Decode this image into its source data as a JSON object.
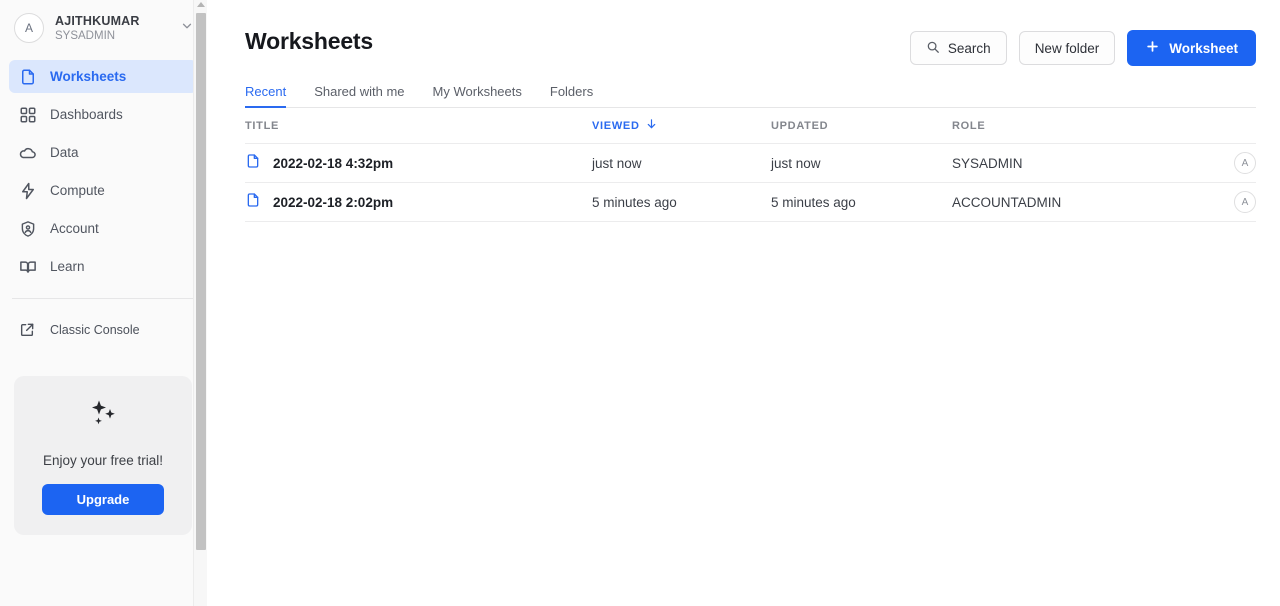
{
  "sidebar": {
    "account": {
      "avatar_initial": "A",
      "name": "AJITHKUMAR",
      "role": "SYSADMIN",
      "chevron_icon": "chevron-down-icon"
    },
    "nav_items": [
      {
        "label": "Worksheets",
        "icon": "document-icon",
        "active": true
      },
      {
        "label": "Dashboards",
        "icon": "grid-icon",
        "active": false
      },
      {
        "label": "Data",
        "icon": "cloud-icon",
        "active": false
      },
      {
        "label": "Compute",
        "icon": "lightning-icon",
        "active": false
      },
      {
        "label": "Account",
        "icon": "shield-person-icon",
        "active": false
      },
      {
        "label": "Learn",
        "icon": "book-icon",
        "active": false
      }
    ],
    "classic_console": {
      "label": "Classic Console",
      "icon": "external-link-icon"
    },
    "trial_card": {
      "icon": "sparkles-icon",
      "message": "Enjoy your free trial!",
      "upgrade_label": "Upgrade"
    },
    "scrollbar": {
      "up_arrow_icon": "scroll-up-arrow-icon"
    }
  },
  "header": {
    "title": "Worksheets",
    "search_label": "Search",
    "search_icon": "search-icon",
    "new_folder_label": "New folder",
    "new_worksheet_label": "Worksheet",
    "new_worksheet_plus_icon": "plus-icon"
  },
  "tabs": [
    {
      "label": "Recent",
      "active": true
    },
    {
      "label": "Shared with me",
      "active": false
    },
    {
      "label": "My Worksheets",
      "active": false
    },
    {
      "label": "Folders",
      "active": false
    }
  ],
  "table": {
    "columns": {
      "title": "TITLE",
      "viewed": "VIEWED",
      "updated": "UPDATED",
      "role": "ROLE"
    },
    "sort": {
      "column": "VIEWED",
      "direction": "desc",
      "icon": "arrow-down-icon"
    },
    "rows": [
      {
        "icon": "worksheet-file-icon",
        "title": "2022-02-18 4:32pm",
        "viewed": "just now",
        "updated": "just now",
        "role": "SYSADMIN",
        "owner_initial": "A"
      },
      {
        "icon": "worksheet-file-icon",
        "title": "2022-02-18 2:02pm",
        "viewed": "5 minutes ago",
        "updated": "5 minutes ago",
        "role": "ACCOUNTADMIN",
        "owner_initial": "A"
      }
    ]
  },
  "annotation": {
    "highlight_color": "#e60000",
    "target": "new-worksheet-button"
  },
  "colors": {
    "accent_blue": "#1c64f2",
    "link_blue": "#2a6af0",
    "active_nav_bg": "#dbe7fd",
    "sidebar_bg": "#fafafa"
  }
}
